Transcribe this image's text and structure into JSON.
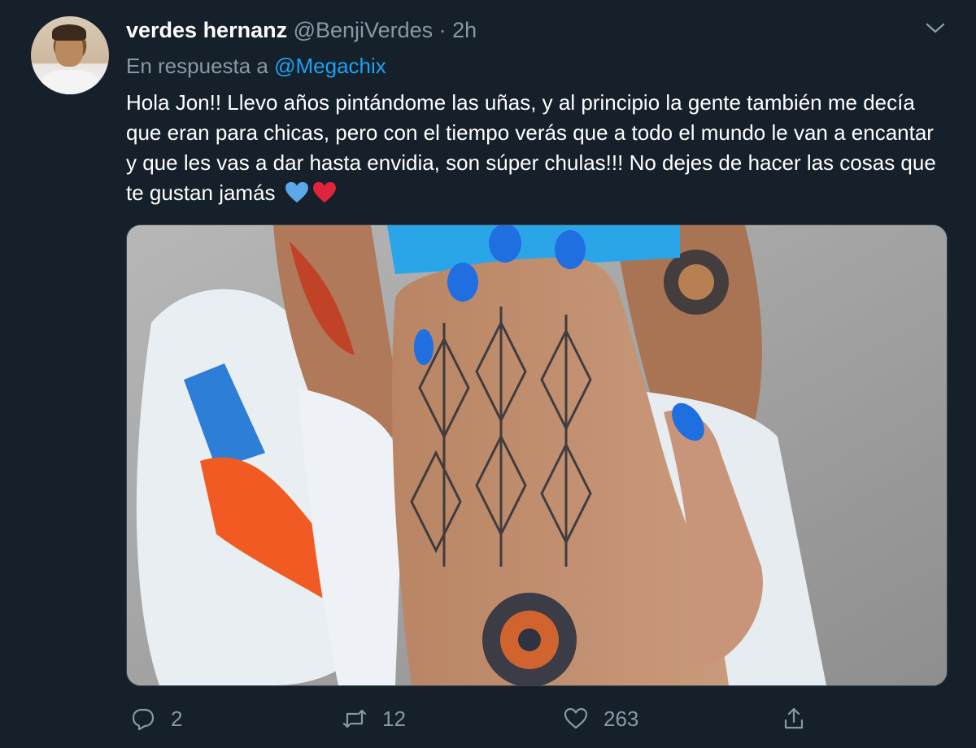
{
  "tweet": {
    "display_name": "verdes hernanz",
    "handle": "@BenjiVerdes",
    "separator": "·",
    "time": "2h",
    "reply_prefix": "En respuesta a",
    "reply_mention": "@Megachix",
    "text": "Hola Jon!! Llevo años pintándome las uñas, y al principio la gente también me decía que eran para chicas, pero con el tiempo verás que a todo el mundo le van a encantar y que les vas a dar hasta envidia, son súper chulas!!! No dejes de hacer las cosas que te gustan jamás",
    "emojis": [
      "blue-heart",
      "red-heart"
    ]
  },
  "actions": {
    "reply_count": "2",
    "retweet_count": "12",
    "like_count": "263"
  },
  "colors": {
    "background": "#15202b",
    "muted": "#8899a6",
    "accent": "#1da1f2",
    "nail_polish": "#1f6fe0"
  },
  "icons": {
    "menu": "chevron-down-icon",
    "reply": "reply-icon",
    "retweet": "retweet-icon",
    "like": "like-icon",
    "share": "share-icon"
  }
}
